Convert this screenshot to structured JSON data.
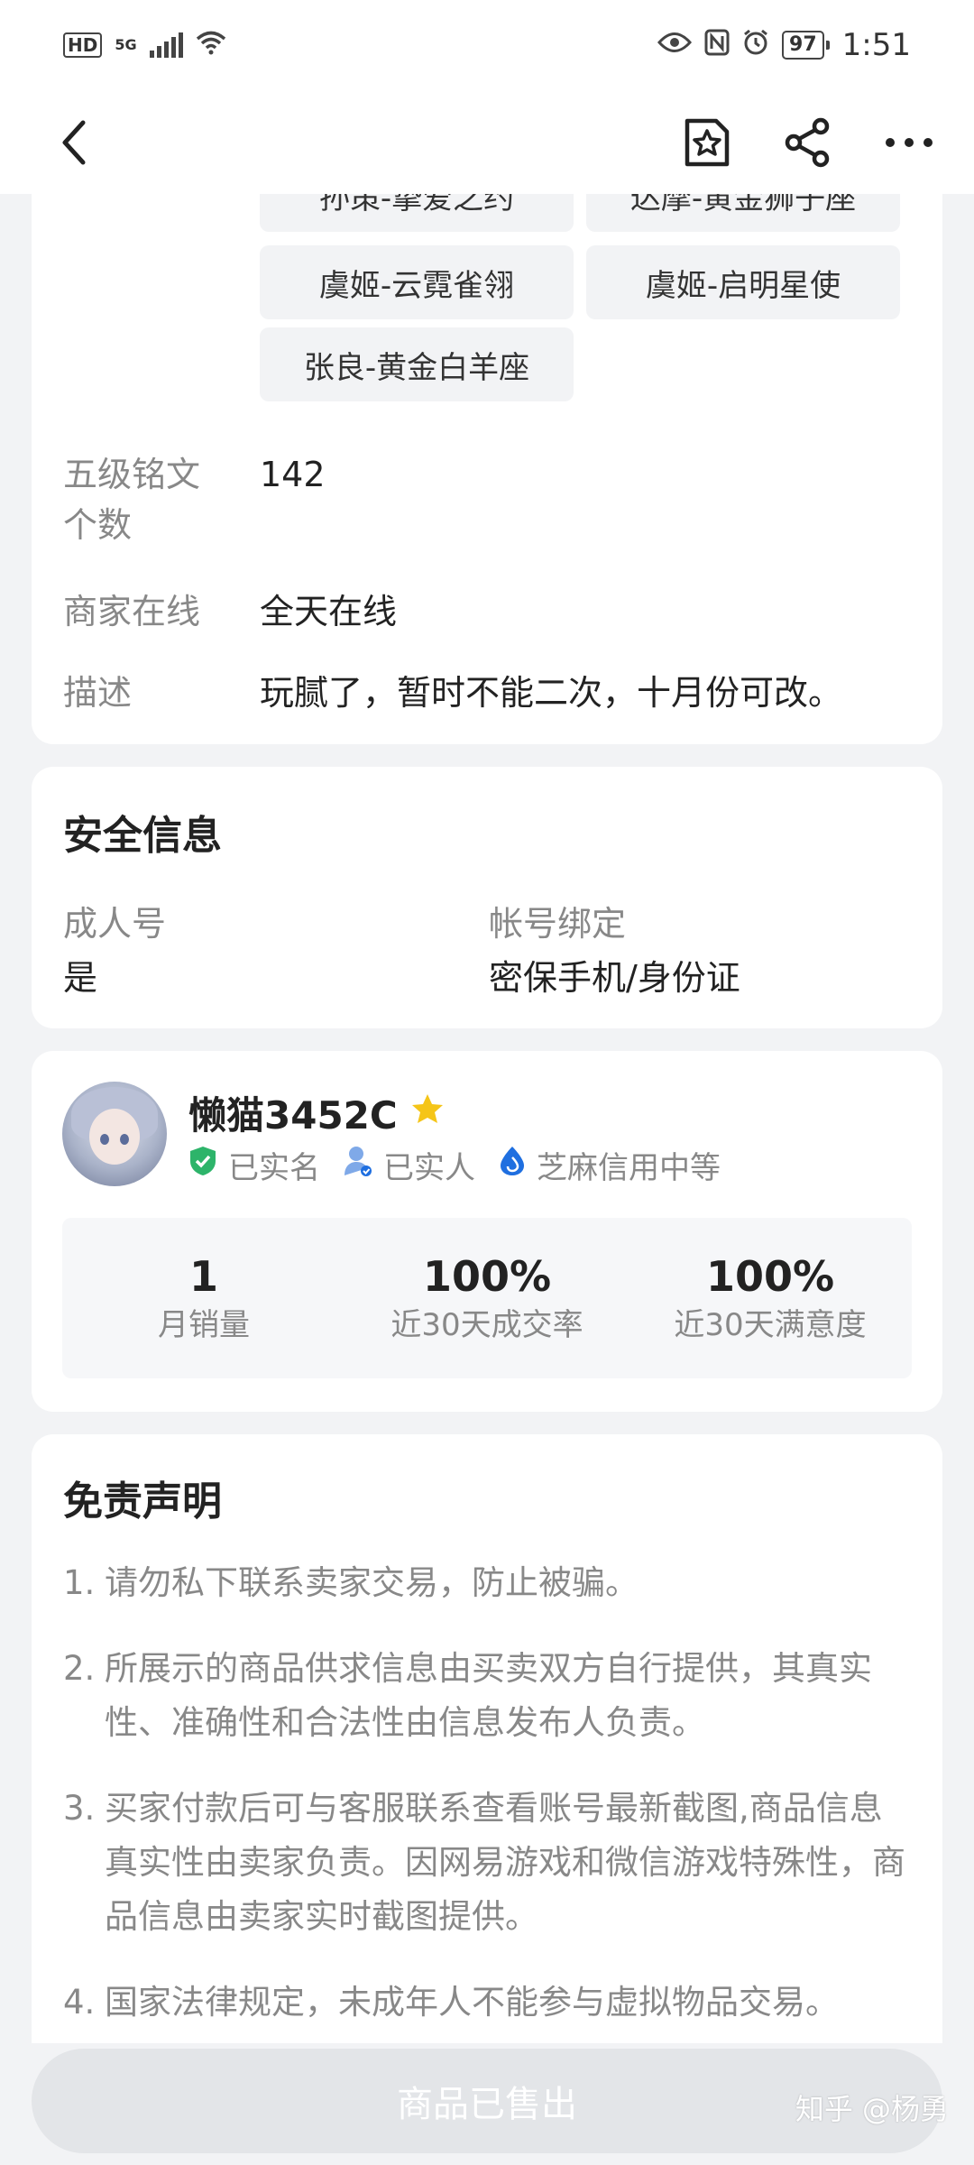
{
  "status_bar": {
    "hd_badge": "HD",
    "network": "5G",
    "battery": "97",
    "time": "1:51"
  },
  "nav": {
    "back_icon": "chevron-left-icon",
    "favorite_icon": "star-bookmark-icon",
    "share_icon": "share-icon",
    "more_icon": "more-horizontal-icon"
  },
  "skins": {
    "items": [
      "孙策-挚爱之约",
      "达摩-黄金狮子座",
      "虞姬-云霓雀翎",
      "虞姬-启明星使",
      "张良-黄金白羊座"
    ]
  },
  "details": {
    "inscription_label_line1": "五级铭文",
    "inscription_label_line2": "个数",
    "inscription_value": "142",
    "online_label": "商家在线",
    "online_value": "全天在线",
    "desc_label": "描述",
    "desc_value": "玩腻了，暂时不能二次，十月份可改。"
  },
  "security": {
    "title": "安全信息",
    "adult_label": "成人号",
    "adult_value": "是",
    "binding_label": "帐号绑定",
    "binding_value": "密保手机/身份证"
  },
  "seller": {
    "name": "懒猫3452C",
    "tags": [
      {
        "icon": "shield-check-icon",
        "label": "已实名"
      },
      {
        "icon": "person-verified-icon",
        "label": "已实人"
      },
      {
        "icon": "sesame-credit-icon",
        "label": "芝麻信用中等"
      }
    ],
    "stats": [
      {
        "value": "1",
        "label": "月销量"
      },
      {
        "value": "100%",
        "label": "近30天成交率"
      },
      {
        "value": "100%",
        "label": "近30天满意度"
      }
    ]
  },
  "disclaimer": {
    "title": "免责声明",
    "items": [
      {
        "num": "1.",
        "text": "请勿私下联系卖家交易，防止被骗。"
      },
      {
        "num": "2.",
        "text": "所展示的商品供求信息由买卖双方自行提供，其真实性、准确性和合法性由信息发布人负责。"
      },
      {
        "num": "3.",
        "text": "买家付款后可与客服联系查看账号最新截图,商品信息真实性由卖家负责。因网易游戏和微信游戏特殊性，商品信息由卖家实时截图提供。"
      },
      {
        "num": "4.",
        "text": "国家法律规定，未成年人不能参与虚拟物品交易。"
      }
    ]
  },
  "bottom": {
    "sold_label": "商品已售出",
    "watermark": "知乎 @杨勇"
  },
  "colors": {
    "background": "#f2f3f5",
    "card": "#ffffff",
    "muted_text": "#888888",
    "verified_green": "#2db46a",
    "credit_blue": "#1f6fe0",
    "star_gold": "#f5c518"
  }
}
